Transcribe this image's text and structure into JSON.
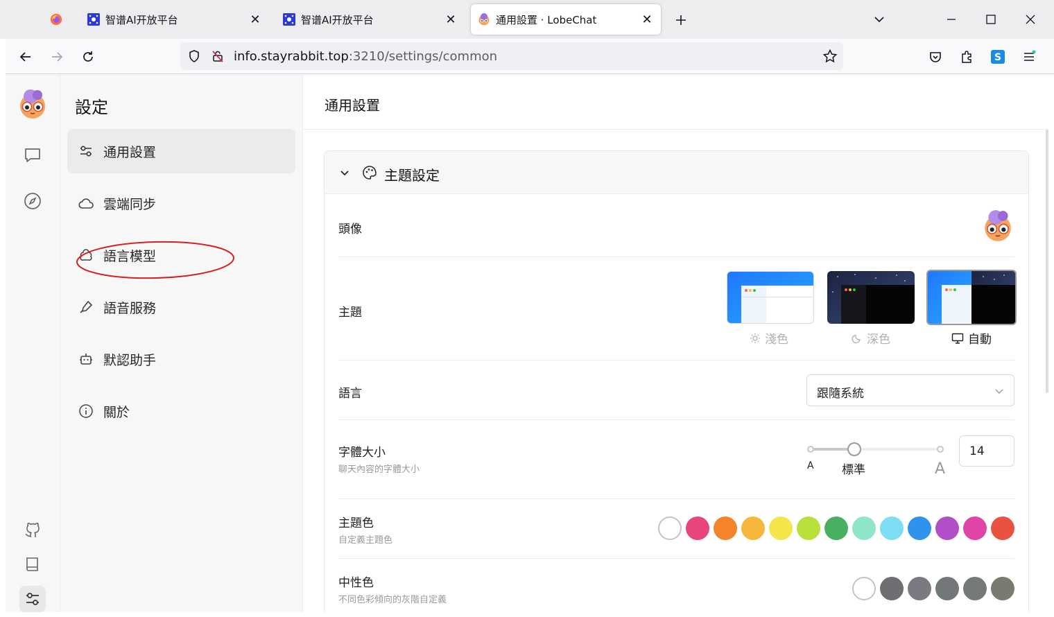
{
  "browser": {
    "tabs": [
      {
        "label": ""
      },
      {
        "label": "智谱AI开放平台"
      },
      {
        "label": "智谱AI开放平台"
      },
      {
        "label": "通用設置 · LobeChat"
      }
    ],
    "url_host": "info.stayrabbit.top",
    "url_path": ":3210/settings/common"
  },
  "sidebar": {
    "title": "設定",
    "items": [
      {
        "label": "通用設置",
        "icon": "sliders-icon"
      },
      {
        "label": "雲端同步",
        "icon": "cloud-icon"
      },
      {
        "label": "語言模型",
        "icon": "brain-icon"
      },
      {
        "label": "語音服務",
        "icon": "mic-icon"
      },
      {
        "label": "默認助手",
        "icon": "bot-icon"
      },
      {
        "label": "關於",
        "icon": "info-icon"
      }
    ]
  },
  "main": {
    "title": "通用設置",
    "section_title": "主題設定",
    "avatar_label": "頭像",
    "theme_label": "主題",
    "theme_options": [
      {
        "label": "淺色",
        "icon": "sun-icon"
      },
      {
        "label": "深色",
        "icon": "moon-icon"
      },
      {
        "label": "自動",
        "icon": "monitor-icon"
      }
    ],
    "language_label": "語言",
    "language_value": "跟隨系統",
    "font_size_label": "字體大小",
    "font_size_desc": "聊天內容的字體大小",
    "font_size_min": "A",
    "font_size_mid": "標準",
    "font_size_max": "A",
    "font_size_value": "14",
    "primary_color_label": "主題色",
    "primary_color_desc": "自定義主題色",
    "primary_colors": [
      "#ffffff",
      "#e8457a",
      "#f5832a",
      "#f7b73b",
      "#f5e44a",
      "#b7e03a",
      "#48b060",
      "#8ee6c9",
      "#7fdcf5",
      "#2f93ee",
      "#b24fc7",
      "#e044a7",
      "#ea5240"
    ],
    "neutral_color_label": "中性色",
    "neutral_color_desc": "不同色彩傾向的灰階自定義",
    "neutral_colors": [
      "#ffffff",
      "#6e6e73",
      "#7a7b82",
      "#72787a",
      "#767a76",
      "#797a70"
    ]
  }
}
